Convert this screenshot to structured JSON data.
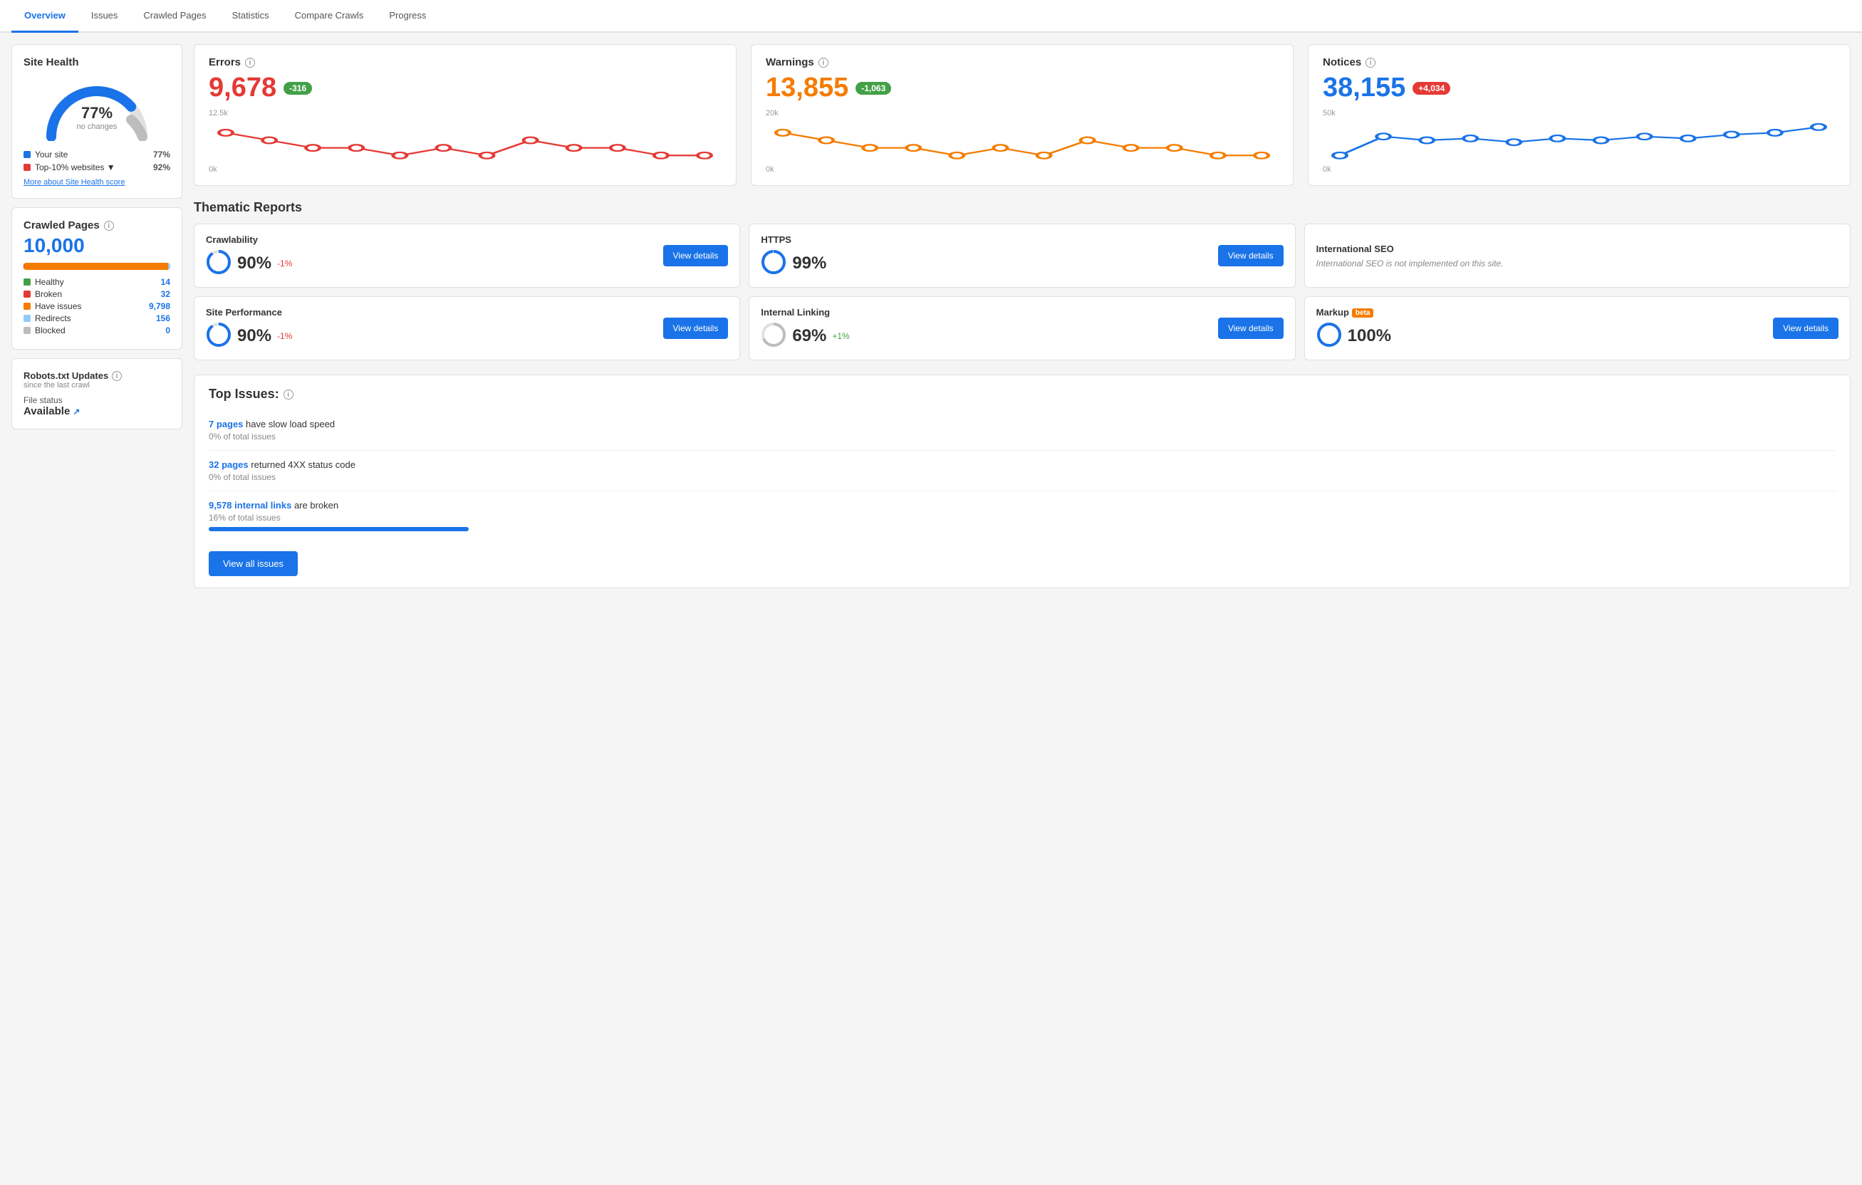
{
  "tabs": [
    {
      "id": "overview",
      "label": "Overview",
      "active": true
    },
    {
      "id": "issues",
      "label": "Issues",
      "active": false
    },
    {
      "id": "crawled-pages",
      "label": "Crawled Pages",
      "active": false
    },
    {
      "id": "statistics",
      "label": "Statistics",
      "active": false
    },
    {
      "id": "compare-crawls",
      "label": "Compare Crawls",
      "active": false
    },
    {
      "id": "progress",
      "label": "Progress",
      "active": false
    }
  ],
  "site_health": {
    "title": "Site Health",
    "percent": "77%",
    "label": "no changes",
    "legend": [
      {
        "name": "Your site",
        "color": "#1a73e8",
        "value": "77%"
      },
      {
        "name": "Top-10% websites",
        "color": "#e53935",
        "value": "92%",
        "arrow": "▼"
      }
    ],
    "more_link": "More about Site Health score"
  },
  "crawled_pages": {
    "title": "Crawled Pages",
    "count": "10,000",
    "segments": [
      {
        "label": "Healthy",
        "color": "#43a047",
        "pct": 0.14,
        "value": "14"
      },
      {
        "label": "Broken",
        "color": "#e53935",
        "pct": 0.32,
        "value": "32"
      },
      {
        "label": "Have issues",
        "color": "#f57c00",
        "pct": 97.98,
        "value": "9,798"
      },
      {
        "label": "Redirects",
        "color": "#90caf9",
        "pct": 1.56,
        "value": "156"
      },
      {
        "label": "Blocked",
        "color": "#bdbdbd",
        "pct": 0,
        "value": "0"
      }
    ]
  },
  "robots": {
    "title": "Robots.txt Updates",
    "info_icon": "i",
    "subtitle": "since the last crawl",
    "file_status_label": "File status",
    "file_status_value": "Available"
  },
  "metrics": [
    {
      "id": "errors",
      "label": "Errors",
      "value": "9,678",
      "type": "errors",
      "badge": "-316",
      "badge_type": "negative",
      "y_max": "12.5k",
      "y_min": "0k",
      "color": "#e53935"
    },
    {
      "id": "warnings",
      "label": "Warnings",
      "value": "13,855",
      "type": "warnings",
      "badge": "-1,063",
      "badge_type": "negative",
      "y_max": "20k",
      "y_min": "0k",
      "color": "#f57c00"
    },
    {
      "id": "notices",
      "label": "Notices",
      "value": "38,155",
      "type": "notices",
      "badge": "+4,034",
      "badge_type": "positive",
      "y_max": "50k",
      "y_min": "0k",
      "color": "#1a73e8"
    }
  ],
  "thematic_reports": {
    "title": "Thematic Reports",
    "reports": [
      {
        "id": "crawlability",
        "title": "Crawlability",
        "percent": "90%",
        "change": "-1%",
        "change_type": "negative",
        "ring_color": "#1a73e8",
        "ring_pct": 90,
        "has_details": true,
        "details_btn": "View details"
      },
      {
        "id": "https",
        "title": "HTTPS",
        "percent": "99%",
        "change": "",
        "change_type": "",
        "ring_color": "#1a73e8",
        "ring_pct": 99,
        "has_details": true,
        "details_btn": "View details"
      },
      {
        "id": "international-seo",
        "title": "International SEO",
        "percent": "",
        "note": "International SEO is not implemented on this site.",
        "has_details": false,
        "ring_pct": 0
      },
      {
        "id": "site-performance",
        "title": "Site Performance",
        "percent": "90%",
        "change": "-1%",
        "change_type": "negative",
        "ring_color": "#1a73e8",
        "ring_pct": 90,
        "has_details": true,
        "details_btn": "View details"
      },
      {
        "id": "internal-linking",
        "title": "Internal Linking",
        "percent": "69%",
        "change": "+1%",
        "change_type": "positive",
        "ring_color": "#bdbdbd",
        "ring_pct": 69,
        "has_details": true,
        "details_btn": "View details"
      },
      {
        "id": "markup",
        "title": "Markup",
        "is_beta": true,
        "percent": "100%",
        "change": "",
        "change_type": "",
        "ring_color": "#1a73e8",
        "ring_pct": 100,
        "has_details": true,
        "details_btn": "View details"
      }
    ]
  },
  "top_issues": {
    "title": "Top Issues:",
    "issues": [
      {
        "id": "slow-load",
        "link_text": "7 pages",
        "text": "have slow load speed",
        "pct_text": "0% of total issues",
        "bar_pct": 0
      },
      {
        "id": "4xx-status",
        "link_text": "32 pages",
        "text": "returned 4XX status code",
        "pct_text": "0% of total issues",
        "bar_pct": 0
      },
      {
        "id": "broken-links",
        "link_text": "9,578 internal links",
        "text": "are broken",
        "pct_text": "16% of total issues",
        "bar_pct": 16
      }
    ],
    "view_all_btn": "View all issues"
  }
}
